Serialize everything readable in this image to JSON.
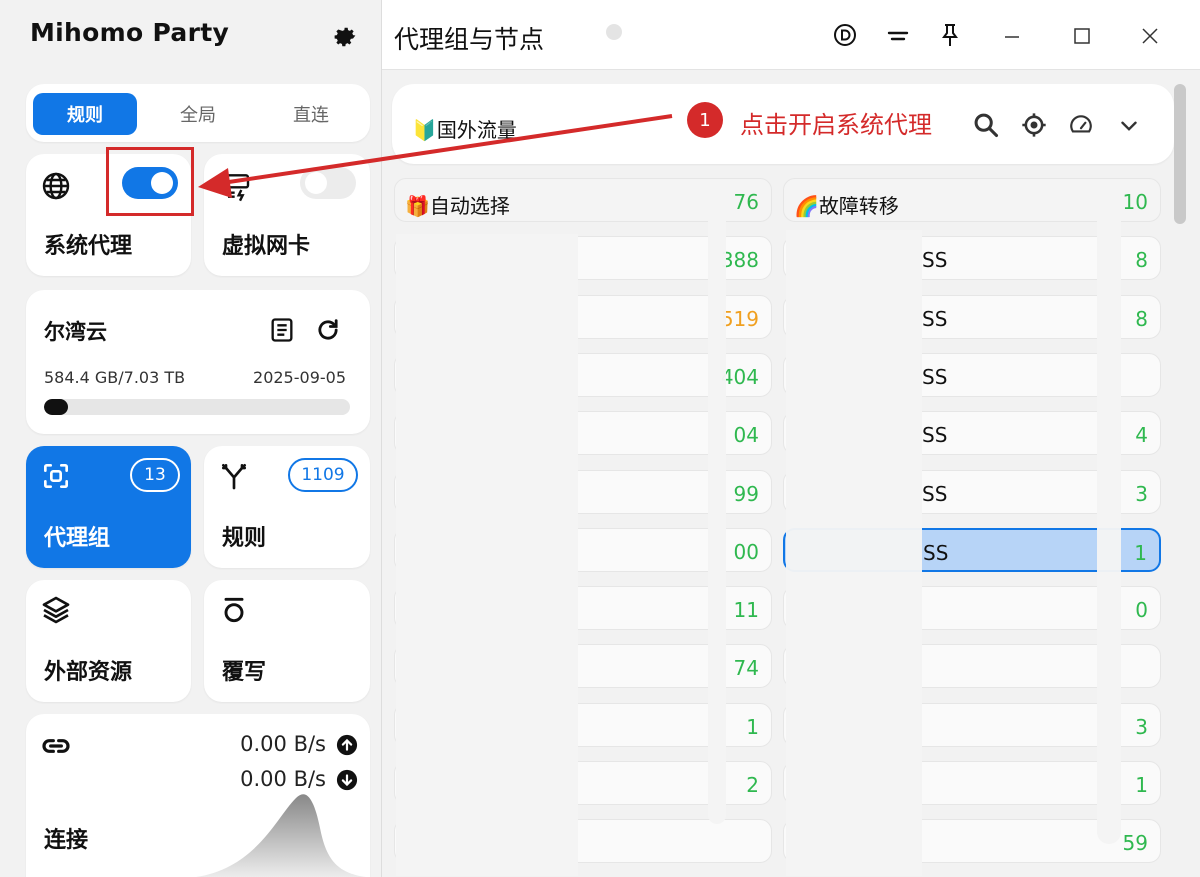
{
  "app": {
    "title": "Mihomo Party"
  },
  "modes": {
    "items": [
      "规则",
      "全局",
      "直连"
    ],
    "active": 0
  },
  "tiles": {
    "system_proxy": {
      "label": "系统代理",
      "enabled": true
    },
    "virtual_nic": {
      "label": "虚拟网卡",
      "enabled": false
    }
  },
  "subscription": {
    "name": "尔湾云",
    "usage": "584.4 GB/7.03 TB",
    "expire": "2025-09-05",
    "progress_percent": 8
  },
  "nav": {
    "proxy_groups": {
      "label": "代理组",
      "count": "13"
    },
    "rules": {
      "label": "规则",
      "count": "1109"
    },
    "resources": {
      "label": "外部资源"
    },
    "override": {
      "label": "覆写"
    }
  },
  "connections": {
    "label": "连接",
    "upload": "0.00 B/s",
    "download": "0.00 B/s"
  },
  "window": {
    "title": "代理组与节点"
  },
  "group_bar": {
    "title": "🔰国外流量"
  },
  "callout": {
    "number": "1",
    "text": "点击开启系统代理"
  },
  "node_columns": {
    "left": {
      "header": {
        "name": "🎁自动选择",
        "delay": "76"
      },
      "rows": [
        {
          "name": "",
          "delay": "388"
        },
        {
          "name": "",
          "delay": "519"
        },
        {
          "name": "",
          "delay": "404"
        },
        {
          "name": "",
          "delay": "04"
        },
        {
          "name": "",
          "delay": "99"
        },
        {
          "name": "",
          "delay": "00"
        },
        {
          "name": "",
          "delay": "11"
        },
        {
          "name": "",
          "delay": "74"
        },
        {
          "name": "",
          "delay": "1"
        },
        {
          "name": "",
          "delay": "2"
        },
        {
          "name": "",
          "delay": ""
        }
      ]
    },
    "right": {
      "header": {
        "name": "🌈故障转移",
        "delay": "10"
      },
      "rows": [
        {
          "name": "SS",
          "delay": "8"
        },
        {
          "name": "SS",
          "delay": "8"
        },
        {
          "name": "SS",
          "delay": ""
        },
        {
          "name": "SS",
          "delay": "4"
        },
        {
          "name": "SS",
          "delay": "3"
        },
        {
          "name": "SS",
          "delay": "1"
        },
        {
          "name": "",
          "delay": "0"
        },
        {
          "name": "",
          "delay": ""
        },
        {
          "name": "",
          "delay": "3"
        },
        {
          "name": "",
          "delay": "1"
        },
        {
          "name": "",
          "delay": "59"
        }
      ]
    }
  },
  "colors": {
    "accent": "#1177e6",
    "delay_green": "#2fb84f",
    "delay_orange": "#f0a020",
    "callout_red": "#d42a2a"
  }
}
